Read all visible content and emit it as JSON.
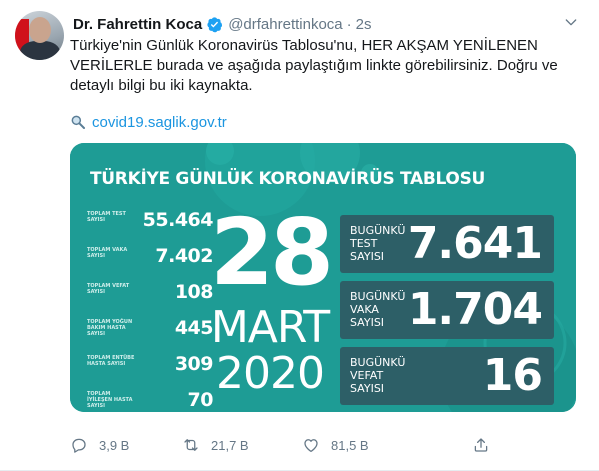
{
  "author": {
    "display_name": "Dr. Fahrettin Koca",
    "handle": "@drfahrettinkoca",
    "separator": "·",
    "time": "2s"
  },
  "tweet": {
    "line1": "Türkiye'nin Günlük Koronavirüs Tablosu'nu, HER AKŞAM YENİLENEN",
    "line2": "VERİLERLE burada ve aşağıda paylaştığım linkte görebilirsiniz. Doğru ve",
    "line3": "detaylı bilgi bu iki kaynakta.",
    "link_text": "covid19.saglik.gov.tr"
  },
  "card": {
    "title": "TÜRKİYE GÜNLÜK KORONAVİRÜS TABLOSU",
    "stats": [
      {
        "label": "TOPLAM TEST SAYISI",
        "value": "55.464"
      },
      {
        "label": "TOPLAM VAKA SAYISI",
        "value": "7.402"
      },
      {
        "label": "TOPLAM VEFAT SAYISI",
        "value": "108"
      },
      {
        "label": "TOPLAM YOĞUN BAKIM HASTA SAYISI",
        "value": "445"
      },
      {
        "label": "TOPLAM ENTÜBE HASTA SAYISI",
        "value": "309"
      },
      {
        "label": "TOPLAM İYİLEŞEN HASTA SAYISI",
        "value": "70"
      }
    ],
    "date": {
      "day": "28",
      "month": "MART",
      "year": "2020"
    },
    "today": [
      {
        "label": "BUGÜNKÜ TEST SAYISI",
        "value": "7.641"
      },
      {
        "label": "BUGÜNKÜ VAKA SAYISI",
        "value": "1.704"
      },
      {
        "label": "BUGÜNKÜ VEFAT SAYISI",
        "value": "16"
      }
    ]
  },
  "actions": {
    "replies": "3,9 B",
    "retweets": "21,7 B",
    "likes": "81,5 B"
  },
  "icons": {
    "verified": "verified-badge-icon",
    "chevron": "chevron-down-icon",
    "search": "magnifier-icon",
    "reply": "reply-icon",
    "retweet": "retweet-icon",
    "like": "heart-icon",
    "share": "share-icon"
  },
  "colors": {
    "accent": "#1da1f2",
    "link": "#1b95e0",
    "card_bg": "#1e9c95",
    "panel_bg": "#2d5f67",
    "muted": "#657786"
  }
}
